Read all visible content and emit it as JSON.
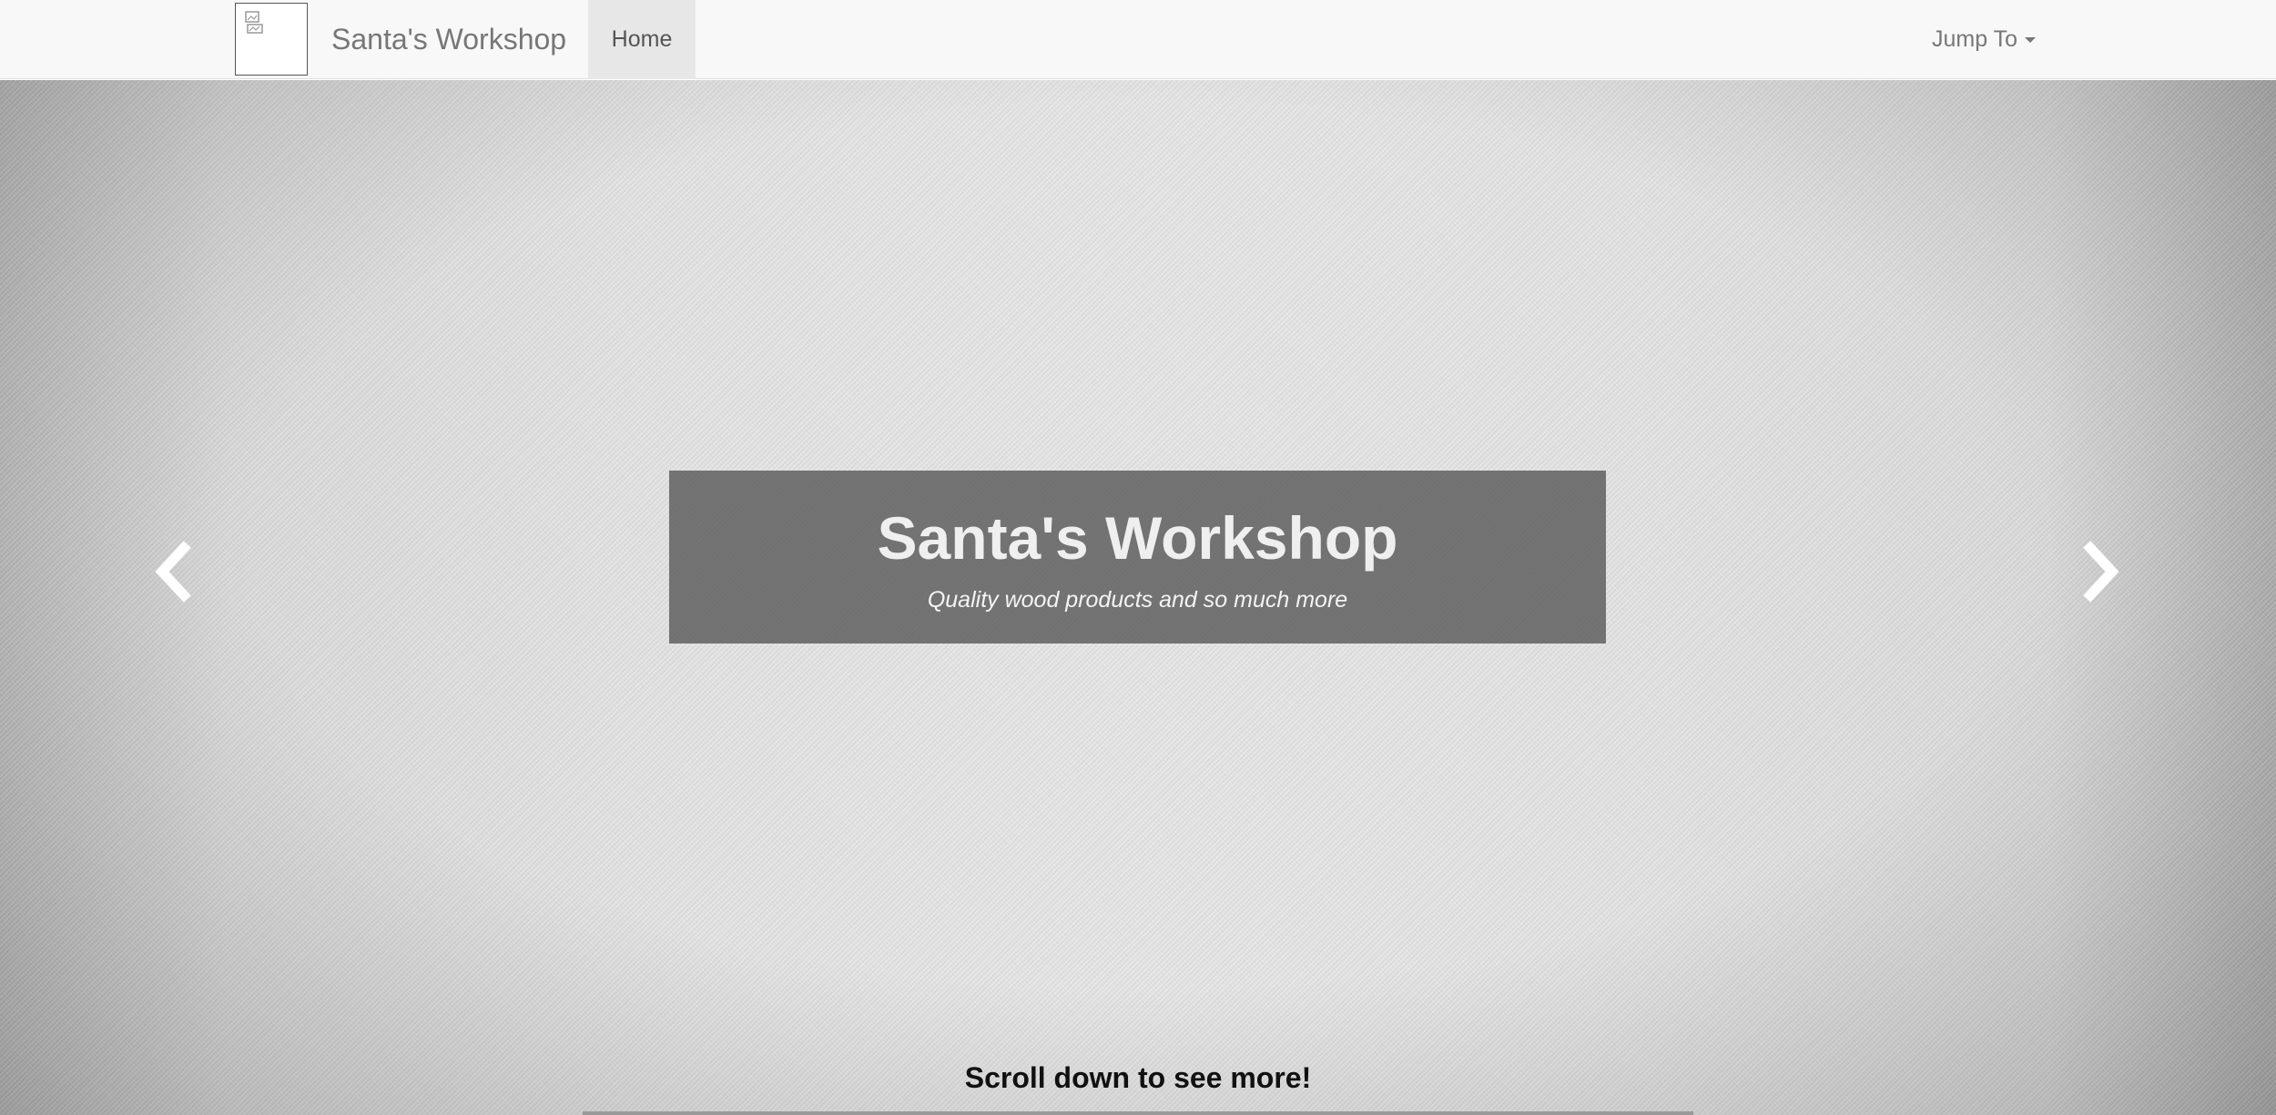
{
  "navbar": {
    "brand_title": "Santa's Workshop",
    "logo_icon": "broken-image-icon",
    "home_label": "Home",
    "jump_label": "Jump To"
  },
  "hero": {
    "title": "Santa's Workshop",
    "subtitle": "Quality wood products and so much more",
    "prev_icon": "chevron-left-icon",
    "next_icon": "chevron-right-icon",
    "scroll_hint": "Scroll down to see more!"
  },
  "colors": {
    "navbar_bg": "#f8f8f8",
    "active_tab_bg": "#e7e7e7",
    "caption_bg": "#5a5a5a",
    "caption_text": "#efefef"
  }
}
